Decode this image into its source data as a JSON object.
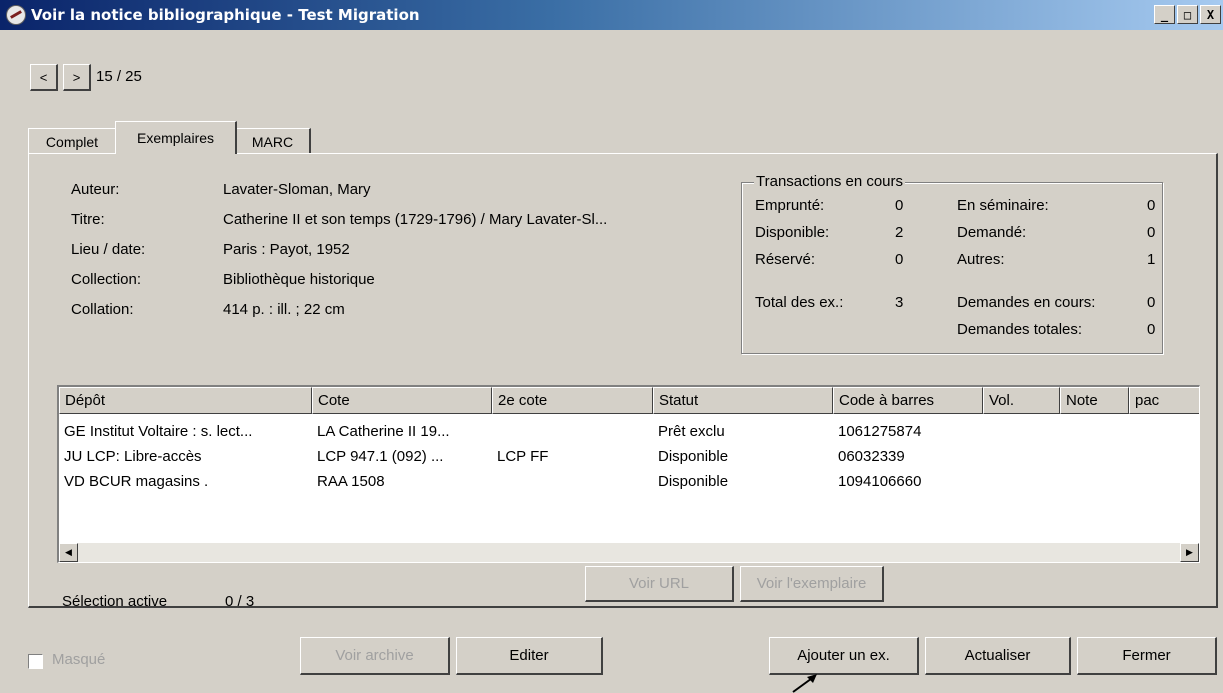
{
  "window": {
    "title": "Voir la notice bibliographique - Test Migration",
    "minimize": "_",
    "maximize": "□",
    "close": "X"
  },
  "nav": {
    "prev": "<",
    "next": ">",
    "counter": "15 / 25"
  },
  "tabs": [
    {
      "label": "Complet",
      "active": false
    },
    {
      "label": "Exemplaires",
      "active": true
    },
    {
      "label": "MARC",
      "active": false
    }
  ],
  "record": {
    "author_label": "Auteur:",
    "author": "Lavater-Sloman, Mary",
    "title_label": "Titre:",
    "title": "Catherine II et son temps (1729-1796) / Mary Lavater-Sl...",
    "place_label": "Lieu / date:",
    "place": "Paris : Payot, 1952",
    "collection_label": "Collection:",
    "collection": "Bibliothèque historique",
    "collation_label": "Collation:",
    "collation": "414 p. : ill. ; 22 cm"
  },
  "transactions": {
    "legend": "Transactions en cours",
    "emprunte_label": "Emprunté:",
    "emprunte": "0",
    "disponible_label": "Disponible:",
    "disponible": "2",
    "reserve_label": "Réservé:",
    "reserve": "0",
    "total_label": "Total des ex.:",
    "total": "3",
    "seminaire_label": "En séminaire:",
    "seminaire": "0",
    "demande_label": "Demandé:",
    "demande": "0",
    "autres_label": "Autres:",
    "autres": "1",
    "demandes_cours_label": "Demandes en cours:",
    "demandes_cours": "0",
    "demandes_totales_label": "Demandes totales:",
    "demandes_totales": "0"
  },
  "table": {
    "columns": [
      "Dépôt",
      "Cote",
      "2e cote",
      "Statut",
      "Code à barres",
      "Vol.",
      "Note",
      "pac"
    ],
    "rows": [
      [
        "GE Institut Voltaire : s. lect...",
        "LA Catherine II 19...",
        "",
        "Prêt exclu",
        "1061275874",
        "",
        "",
        ""
      ],
      [
        "JU LCP: Libre-accès",
        "LCP 947.1 (092) ...",
        "LCP FF",
        "Disponible",
        "06032339",
        "",
        "",
        ""
      ],
      [
        "VD BCUR magasins .",
        "RAA 1508",
        "",
        "Disponible",
        "1094106660",
        "",
        "",
        ""
      ]
    ]
  },
  "selection": {
    "label": "Sélection active",
    "value": "0 / 3"
  },
  "buttons": {
    "voir_url": "Voir URL",
    "voir_exemplaire": "Voir l'exemplaire",
    "voir_archive": "Voir archive",
    "editer": "Editer",
    "ajouter": "Ajouter un ex.",
    "actualiser": "Actualiser",
    "fermer": "Fermer"
  },
  "masque": {
    "label": "Masqué",
    "checked": false
  }
}
